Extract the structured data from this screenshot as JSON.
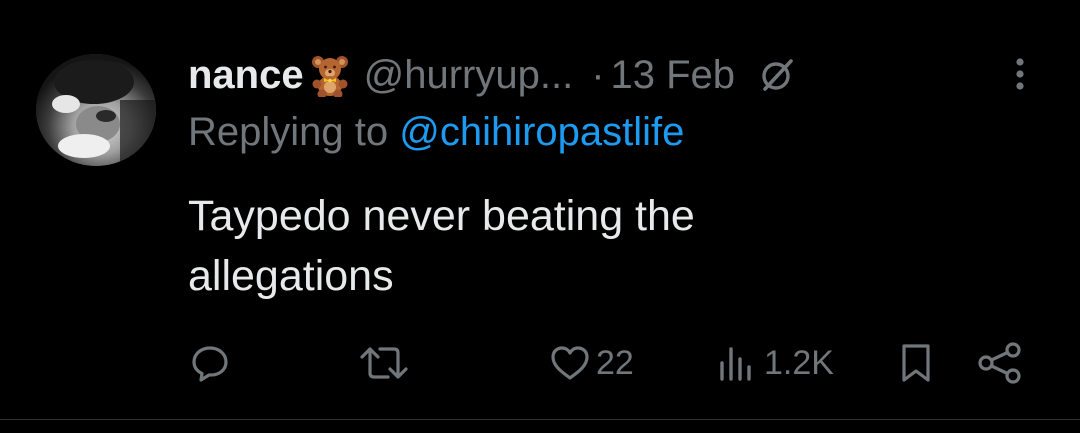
{
  "tweet": {
    "display_name": "nance",
    "name_emoji": "teddy-bear",
    "handle": "@hurryup...",
    "separator": "·",
    "timestamp": "13 Feb",
    "reply_prefix": "Replying to ",
    "reply_handle": "@chihiropastlife",
    "text_line1": "Taypedo never beating the",
    "text_line2": "allegations"
  },
  "actions": {
    "reply_icon": "comment-icon",
    "retweet_icon": "retweet-icon",
    "like_icon": "heart-icon",
    "like_count": "22",
    "views_icon": "bar-chart-icon",
    "views_count": "1.2K",
    "bookmark_icon": "bookmark-icon",
    "share_icon": "share-icon"
  },
  "colors": {
    "background": "#000000",
    "text": "#e7e9ea",
    "muted": "#71767b",
    "link": "#1d9bf0",
    "divider": "#2f3336"
  }
}
